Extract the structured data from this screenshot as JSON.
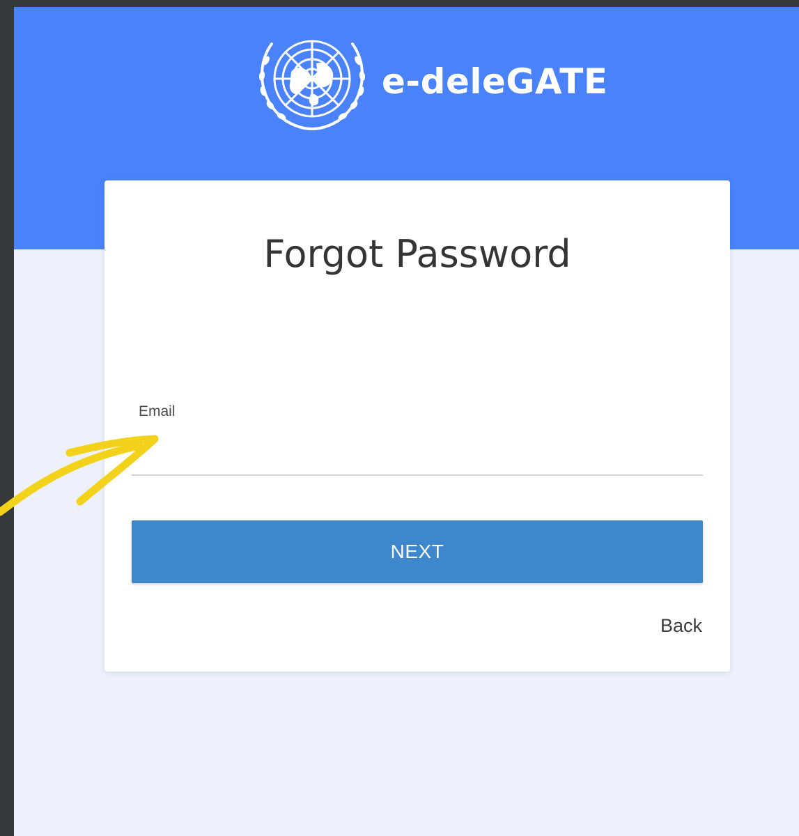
{
  "header": {
    "brand_name": "e-deleGATE",
    "emblem_icon": "un-emblem-icon",
    "background_color": "#4a82fb"
  },
  "form": {
    "title": "Forgot Password",
    "email_label": "Email",
    "email_value": "",
    "next_label": "NEXT",
    "back_label": "Back",
    "button_color": "#3f87cc"
  },
  "annotation": {
    "arrow_icon": "yellow-arrow-icon",
    "arrow_color": "#f2d21b"
  }
}
